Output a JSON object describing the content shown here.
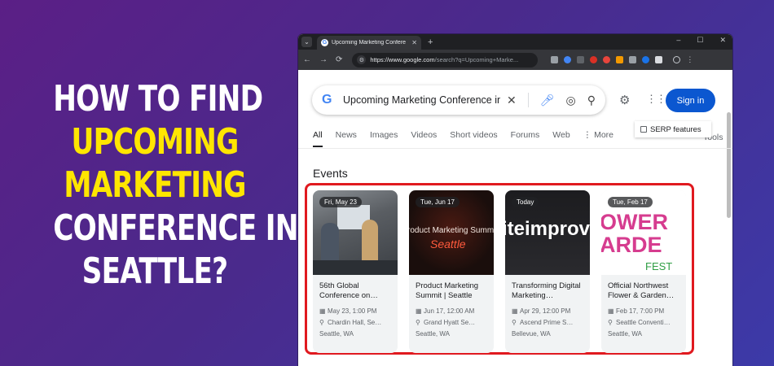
{
  "headline": {
    "line1": "HOW TO FIND",
    "line2": "UPCOMING",
    "line3": "MARKETING",
    "line4": "CONFERENCE IN",
    "line5": "SEATTLE?"
  },
  "colors": {
    "accent_yellow": "#ffe600",
    "highlight_red": "#e0191f",
    "signin_blue": "#0b57d0"
  },
  "browser": {
    "tab_title": "Upcoming Marketing Confere",
    "new_tab": "+",
    "tab_close": "✕",
    "window_controls": {
      "minimize": "–",
      "maximize": "☐",
      "close": "✕"
    },
    "url_host": "https://www.google.com",
    "url_path": "/search?q=Upcoming+Marke..."
  },
  "google": {
    "logo": "G",
    "query": "Upcoming Marketing Conference in Sea",
    "signin_label": "Sign in",
    "serp_features": "SERP features",
    "tools": "Tools",
    "tabs": [
      "All",
      "News",
      "Images",
      "Videos",
      "Short videos",
      "Forums",
      "Web",
      "⋮ More"
    ],
    "events_heading": "Events"
  },
  "events": [
    {
      "badge": "Fri, May 23",
      "title": "56th Global Conference on…",
      "datetime": "May 23, 1:00 PM",
      "venue": "Chardin Hall, Se…",
      "city": "Seattle, WA",
      "thumb_text": ""
    },
    {
      "badge": "Tue, Jun 17",
      "title": "Product Marketing Summit | Seattle",
      "datetime": "Jun 17, 12:00 AM",
      "venue": "Grand Hyatt Se…",
      "city": "Seattle, WA",
      "thumb_text": "roduct Marketing Summ",
      "thumb_text2": "Seattle"
    },
    {
      "badge": "Today",
      "title": "Transforming Digital Marketing…",
      "datetime": "Apr 29, 12:00 PM",
      "venue": "Ascend Prime S…",
      "city": "Bellevue, WA",
      "thumb_text": "iteimprov"
    },
    {
      "badge": "Tue, Feb 17",
      "title": "Official Northwest Flower & Garden…",
      "datetime": "Feb 17, 7:00 PM",
      "venue": "Seattle Conventi…",
      "city": "Seattle, WA",
      "thumb_text": "OWER",
      "thumb_text2": "ARDE",
      "thumb_text3": "FEST"
    }
  ]
}
